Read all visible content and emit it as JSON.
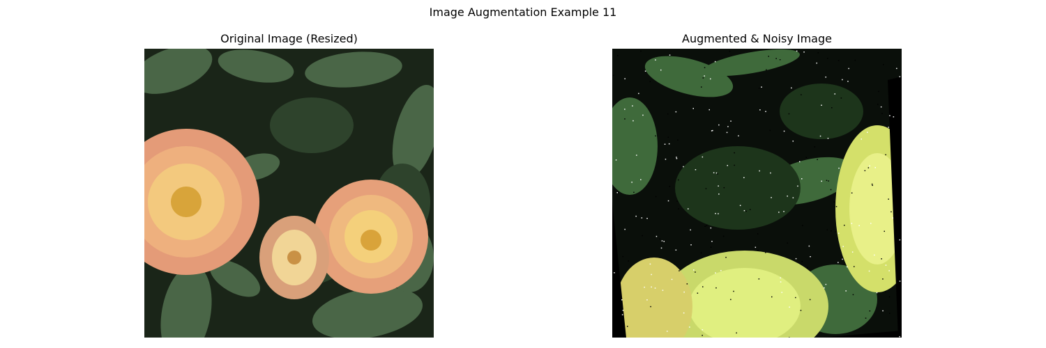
{
  "figure": {
    "suptitle": "Image Augmentation Example 11"
  },
  "panels": [
    {
      "title": "Original Image (Resized)",
      "content": "photo of orange and yellow dahlia flowers among dark green leaves"
    },
    {
      "title": "Augmented & Noisy Image",
      "content": "rotated, color-shifted version of the dahlia photo with salt-and-pepper noise and black corners"
    }
  ],
  "colors": {
    "background": "#ffffff",
    "leaf_dark": "#1b2a1b",
    "leaf": "#4d6b4a",
    "petal_orange": "#e9a27a",
    "petal_yellow": "#f3d079",
    "petal_lime": "#d9ef72"
  }
}
